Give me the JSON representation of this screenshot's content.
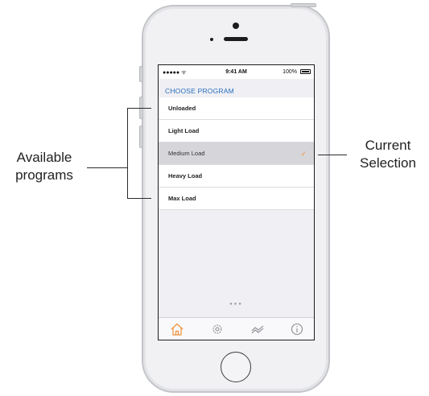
{
  "status_bar": {
    "signal": "●●●●● ᯤ",
    "time": "9:41 AM",
    "battery_pct": "100%"
  },
  "screen": {
    "section_header": "CHOOSE PROGRAM",
    "programs": [
      {
        "label": "Unloaded",
        "selected": false
      },
      {
        "label": "Light Load",
        "selected": false
      },
      {
        "label": "Medium Load",
        "selected": true
      },
      {
        "label": "Heavy Load",
        "selected": false
      },
      {
        "label": "Max Load",
        "selected": false
      }
    ],
    "checkmark": "✓",
    "page_dots": "●●●",
    "tabs": [
      {
        "icon": "home-icon",
        "active": true
      },
      {
        "icon": "gear-icon",
        "active": false
      },
      {
        "icon": "chart-icon",
        "active": false
      },
      {
        "icon": "info-icon",
        "active": false
      }
    ]
  },
  "annotations": {
    "left_line1": "Available",
    "left_line2": "programs",
    "right_line1": "Current",
    "right_line2": "Selection"
  },
  "colors": {
    "accent": "#f0923a",
    "header_blue": "#2a6fba",
    "selected_row": "#d6d6da"
  }
}
